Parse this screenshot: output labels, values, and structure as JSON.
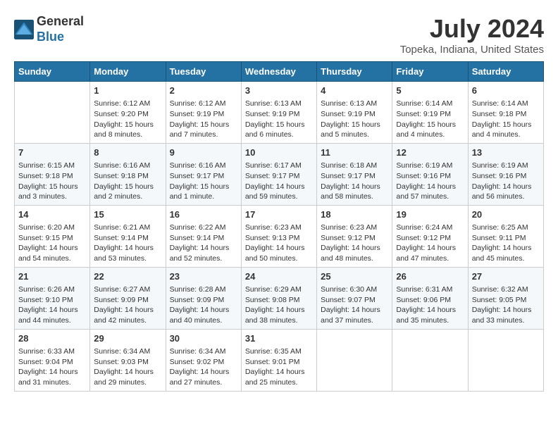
{
  "logo": {
    "line1": "General",
    "line2": "Blue"
  },
  "title": "July 2024",
  "subtitle": "Topeka, Indiana, United States",
  "weekdays": [
    "Sunday",
    "Monday",
    "Tuesday",
    "Wednesday",
    "Thursday",
    "Friday",
    "Saturday"
  ],
  "weeks": [
    [
      {
        "day": "",
        "info": ""
      },
      {
        "day": "1",
        "info": "Sunrise: 6:12 AM\nSunset: 9:20 PM\nDaylight: 15 hours\nand 8 minutes."
      },
      {
        "day": "2",
        "info": "Sunrise: 6:12 AM\nSunset: 9:19 PM\nDaylight: 15 hours\nand 7 minutes."
      },
      {
        "day": "3",
        "info": "Sunrise: 6:13 AM\nSunset: 9:19 PM\nDaylight: 15 hours\nand 6 minutes."
      },
      {
        "day": "4",
        "info": "Sunrise: 6:13 AM\nSunset: 9:19 PM\nDaylight: 15 hours\nand 5 minutes."
      },
      {
        "day": "5",
        "info": "Sunrise: 6:14 AM\nSunset: 9:19 PM\nDaylight: 15 hours\nand 4 minutes."
      },
      {
        "day": "6",
        "info": "Sunrise: 6:14 AM\nSunset: 9:18 PM\nDaylight: 15 hours\nand 4 minutes."
      }
    ],
    [
      {
        "day": "7",
        "info": "Sunrise: 6:15 AM\nSunset: 9:18 PM\nDaylight: 15 hours\nand 3 minutes."
      },
      {
        "day": "8",
        "info": "Sunrise: 6:16 AM\nSunset: 9:18 PM\nDaylight: 15 hours\nand 2 minutes."
      },
      {
        "day": "9",
        "info": "Sunrise: 6:16 AM\nSunset: 9:17 PM\nDaylight: 15 hours\nand 1 minute."
      },
      {
        "day": "10",
        "info": "Sunrise: 6:17 AM\nSunset: 9:17 PM\nDaylight: 14 hours\nand 59 minutes."
      },
      {
        "day": "11",
        "info": "Sunrise: 6:18 AM\nSunset: 9:17 PM\nDaylight: 14 hours\nand 58 minutes."
      },
      {
        "day": "12",
        "info": "Sunrise: 6:19 AM\nSunset: 9:16 PM\nDaylight: 14 hours\nand 57 minutes."
      },
      {
        "day": "13",
        "info": "Sunrise: 6:19 AM\nSunset: 9:16 PM\nDaylight: 14 hours\nand 56 minutes."
      }
    ],
    [
      {
        "day": "14",
        "info": "Sunrise: 6:20 AM\nSunset: 9:15 PM\nDaylight: 14 hours\nand 54 minutes."
      },
      {
        "day": "15",
        "info": "Sunrise: 6:21 AM\nSunset: 9:14 PM\nDaylight: 14 hours\nand 53 minutes."
      },
      {
        "day": "16",
        "info": "Sunrise: 6:22 AM\nSunset: 9:14 PM\nDaylight: 14 hours\nand 52 minutes."
      },
      {
        "day": "17",
        "info": "Sunrise: 6:23 AM\nSunset: 9:13 PM\nDaylight: 14 hours\nand 50 minutes."
      },
      {
        "day": "18",
        "info": "Sunrise: 6:23 AM\nSunset: 9:12 PM\nDaylight: 14 hours\nand 48 minutes."
      },
      {
        "day": "19",
        "info": "Sunrise: 6:24 AM\nSunset: 9:12 PM\nDaylight: 14 hours\nand 47 minutes."
      },
      {
        "day": "20",
        "info": "Sunrise: 6:25 AM\nSunset: 9:11 PM\nDaylight: 14 hours\nand 45 minutes."
      }
    ],
    [
      {
        "day": "21",
        "info": "Sunrise: 6:26 AM\nSunset: 9:10 PM\nDaylight: 14 hours\nand 44 minutes."
      },
      {
        "day": "22",
        "info": "Sunrise: 6:27 AM\nSunset: 9:09 PM\nDaylight: 14 hours\nand 42 minutes."
      },
      {
        "day": "23",
        "info": "Sunrise: 6:28 AM\nSunset: 9:09 PM\nDaylight: 14 hours\nand 40 minutes."
      },
      {
        "day": "24",
        "info": "Sunrise: 6:29 AM\nSunset: 9:08 PM\nDaylight: 14 hours\nand 38 minutes."
      },
      {
        "day": "25",
        "info": "Sunrise: 6:30 AM\nSunset: 9:07 PM\nDaylight: 14 hours\nand 37 minutes."
      },
      {
        "day": "26",
        "info": "Sunrise: 6:31 AM\nSunset: 9:06 PM\nDaylight: 14 hours\nand 35 minutes."
      },
      {
        "day": "27",
        "info": "Sunrise: 6:32 AM\nSunset: 9:05 PM\nDaylight: 14 hours\nand 33 minutes."
      }
    ],
    [
      {
        "day": "28",
        "info": "Sunrise: 6:33 AM\nSunset: 9:04 PM\nDaylight: 14 hours\nand 31 minutes."
      },
      {
        "day": "29",
        "info": "Sunrise: 6:34 AM\nSunset: 9:03 PM\nDaylight: 14 hours\nand 29 minutes."
      },
      {
        "day": "30",
        "info": "Sunrise: 6:34 AM\nSunset: 9:02 PM\nDaylight: 14 hours\nand 27 minutes."
      },
      {
        "day": "31",
        "info": "Sunrise: 6:35 AM\nSunset: 9:01 PM\nDaylight: 14 hours\nand 25 minutes."
      },
      {
        "day": "",
        "info": ""
      },
      {
        "day": "",
        "info": ""
      },
      {
        "day": "",
        "info": ""
      }
    ]
  ]
}
